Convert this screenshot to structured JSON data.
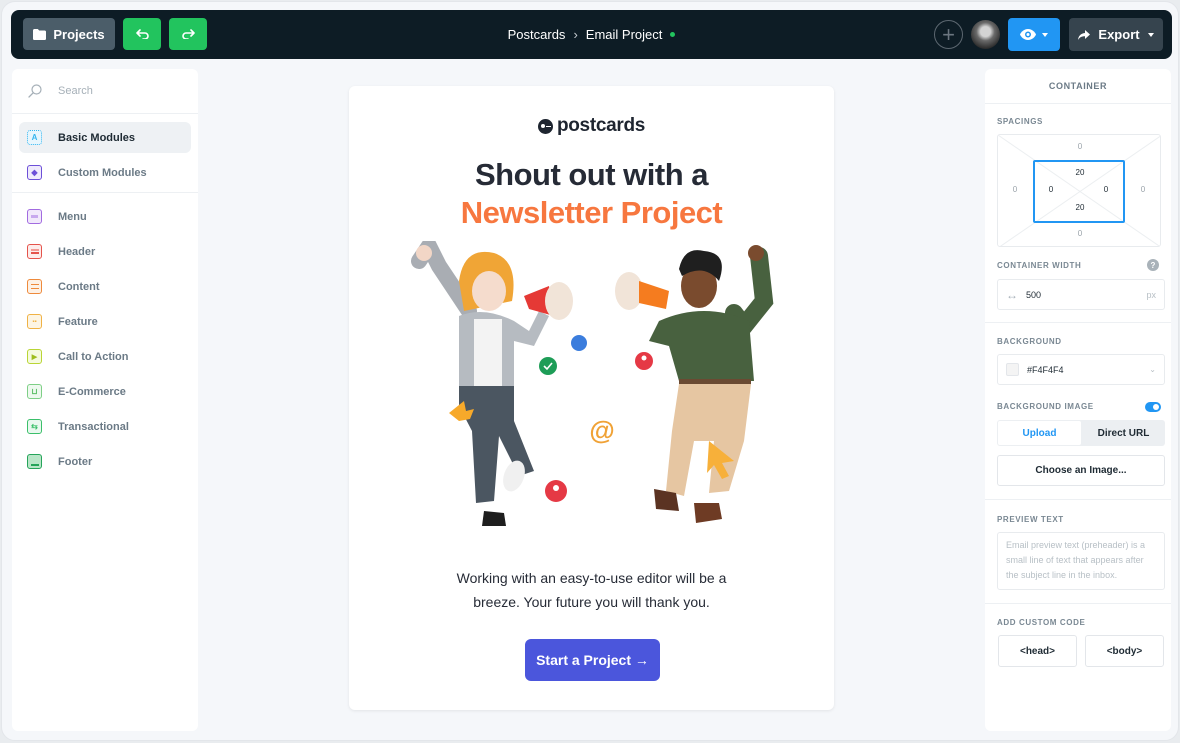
{
  "topbar": {
    "projects_label": "Projects",
    "undo_icon": "undo-icon",
    "redo_icon": "redo-icon",
    "breadcrumb": {
      "root": "Postcards",
      "separator": "›",
      "current": "Email Project",
      "status_color": "#22c45e"
    },
    "add_icon": "plus-circle-icon",
    "avatar": "user-avatar",
    "preview_icon": "eye-icon",
    "export_label": "Export"
  },
  "sidebar": {
    "search_placeholder": "Search",
    "groups": [
      {
        "label": "Basic Modules",
        "icon": "A",
        "color": "#33b5f0",
        "active": true
      },
      {
        "label": "Custom Modules",
        "icon": "◆",
        "color": "#6c4fd8",
        "active": false
      }
    ],
    "modules": [
      {
        "label": "Menu",
        "color": "#a26be0"
      },
      {
        "label": "Header",
        "color": "#e5534b"
      },
      {
        "label": "Content",
        "color": "#ee8a3c"
      },
      {
        "label": "Feature",
        "color": "#f0b245"
      },
      {
        "label": "Call to Action",
        "color": "#b9d535"
      },
      {
        "label": "E-Commerce",
        "color": "#7ecf86"
      },
      {
        "label": "Transactional",
        "color": "#3bbf6a"
      },
      {
        "label": "Footer",
        "color": "#25a45a"
      }
    ]
  },
  "email": {
    "logo": "postcards",
    "headline_1": "Shout out with a",
    "headline_2": "Newsletter Project",
    "body_1": "Working with an easy-to-use editor will be a",
    "body_2": "breeze. Your future you will thank you.",
    "cta": "Start a Project →",
    "accent": "#f7773f",
    "cta_color": "#4b56dc"
  },
  "panel": {
    "title": "CONTAINER",
    "spacings_label": "SPACINGS",
    "margin": {
      "top": "0",
      "right": "0",
      "bottom": "0",
      "left": "0"
    },
    "padding": {
      "top": "20",
      "right": "0",
      "bottom": "20",
      "left": "0"
    },
    "width_label": "CONTAINER WIDTH",
    "width_value": "500",
    "width_unit": "px",
    "help": "?",
    "background_label": "BACKGROUND",
    "background_value": "#F4F4F4",
    "bg_image_label": "BACKGROUND IMAGE",
    "bg_image_enabled": true,
    "upload_tab": "Upload",
    "url_tab": "Direct URL",
    "choose_image": "Choose an Image...",
    "preview_label": "PREVIEW TEXT",
    "preview_placeholder": "Email preview text (preheader) is a small line of text that appears after the subject line in the inbox.",
    "custom_code_label": "ADD CUSTOM CODE",
    "head_btn": "<head>",
    "body_btn": "<body>"
  }
}
